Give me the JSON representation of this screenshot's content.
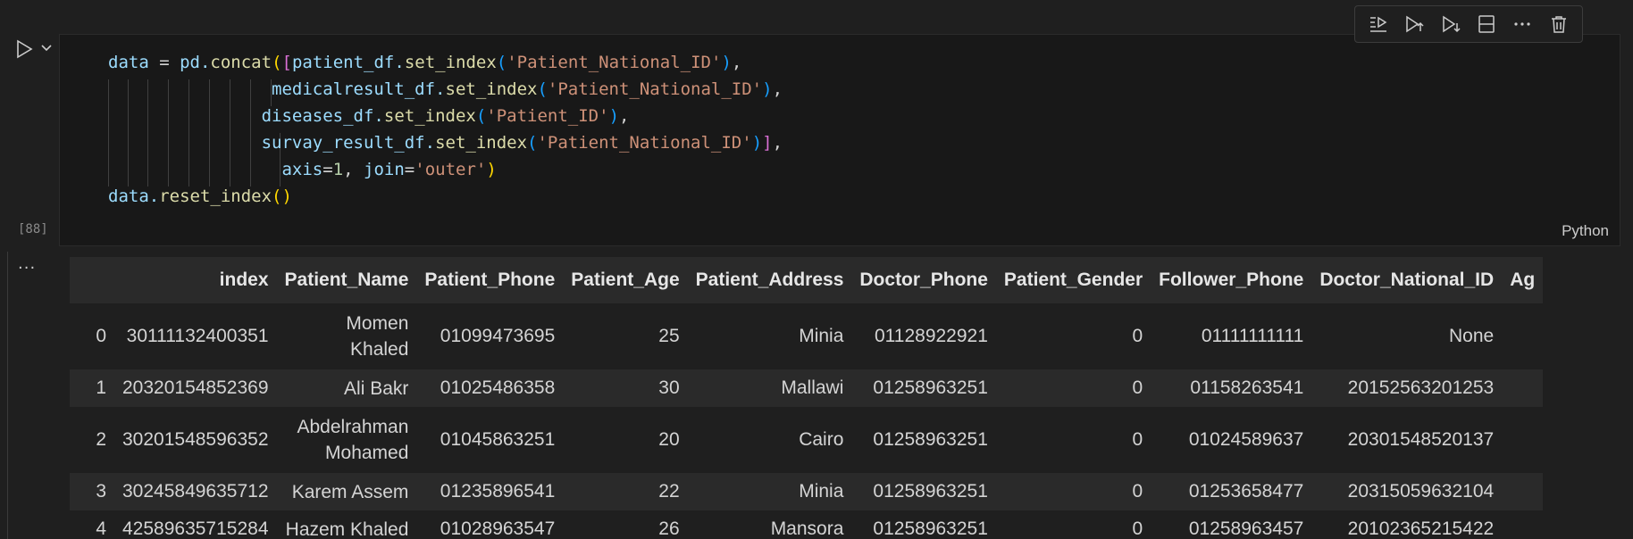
{
  "toolbar": {
    "buttons": [
      {
        "name": "execute-above-cells",
        "icon": "run-above-icon"
      },
      {
        "name": "execute-cell-and-below",
        "icon": "run-below-icon"
      },
      {
        "name": "execute-cell-below",
        "icon": "run-next-icon"
      },
      {
        "name": "split-cell",
        "icon": "split-cell-icon"
      },
      {
        "name": "more-actions",
        "icon": "more-icon",
        "label": "···"
      },
      {
        "name": "delete-cell",
        "icon": "trash-icon"
      }
    ]
  },
  "cell": {
    "execution_count": "[88]",
    "language": "Python",
    "code": {
      "l1_a": "data",
      "l1_b": " = ",
      "l1_c": "pd.",
      "l1_d": "concat",
      "l1_e": "(",
      "l1_f": "[",
      "l1_g": "patient_df.",
      "l1_h": "set_index",
      "l1_i": "(",
      "l1_j": "'Patient_National_ID'",
      "l1_k": ")",
      "l1_l": ",",
      "l2_a": "medicalresult_df.",
      "l2_b": "set_index",
      "l2_c": "(",
      "l2_d": "'Patient_National_ID'",
      "l2_e": ")",
      "l2_f": ",",
      "l3_a": "diseases_df.",
      "l3_b": "set_index",
      "l3_c": "(",
      "l3_d": "'Patient_ID'",
      "l3_e": ")",
      "l3_f": ",",
      "l4_a": "survay_result_df.",
      "l4_b": "set_index",
      "l4_c": "(",
      "l4_d": "'Patient_National_ID'",
      "l4_e": ")",
      "l4_f": "]",
      "l4_g": ",",
      "l5_a": "axis",
      "l5_b": "=",
      "l5_c": "1",
      "l5_d": ", ",
      "l5_e": "join",
      "l5_f": "=",
      "l5_g": "'outer'",
      "l5_h": ")",
      "l6_a": "data.",
      "l6_b": "reset_index",
      "l6_c": "()"
    }
  },
  "output": {
    "more_label": "···",
    "columns": [
      "",
      "index",
      "Patient_Name",
      "Patient_Phone",
      "Patient_Age",
      "Patient_Address",
      "Doctor_Phone",
      "Patient_Gender",
      "Follower_Phone",
      "Doctor_National_ID",
      "Ag"
    ],
    "rows": [
      [
        "0",
        "30111132400351",
        "Momen Khaled",
        "01099473695",
        "25",
        "Minia",
        "01128922921",
        "0",
        "01111111111",
        "None",
        ""
      ],
      [
        "1",
        "20320154852369",
        "Ali Bakr",
        "01025486358",
        "30",
        "Mallawi",
        "01258963251",
        "0",
        "01158263541",
        "20152563201253",
        ""
      ],
      [
        "2",
        "30201548596352",
        "Abdelrahman Mohamed",
        "01045863251",
        "20",
        "Cairo",
        "01258963251",
        "0",
        "01024589637",
        "20301548520137",
        ""
      ],
      [
        "3",
        "30245849635712",
        "Karem Assem",
        "01235896541",
        "22",
        "Minia",
        "01258963251",
        "0",
        "01253658477",
        "20315059632104",
        ""
      ],
      [
        "4",
        "42589635715284",
        "Hazem Khaled",
        "01028963547",
        "26",
        "Mansora",
        "01258963251",
        "0",
        "01258963457",
        "20102365215422",
        ""
      ]
    ]
  }
}
